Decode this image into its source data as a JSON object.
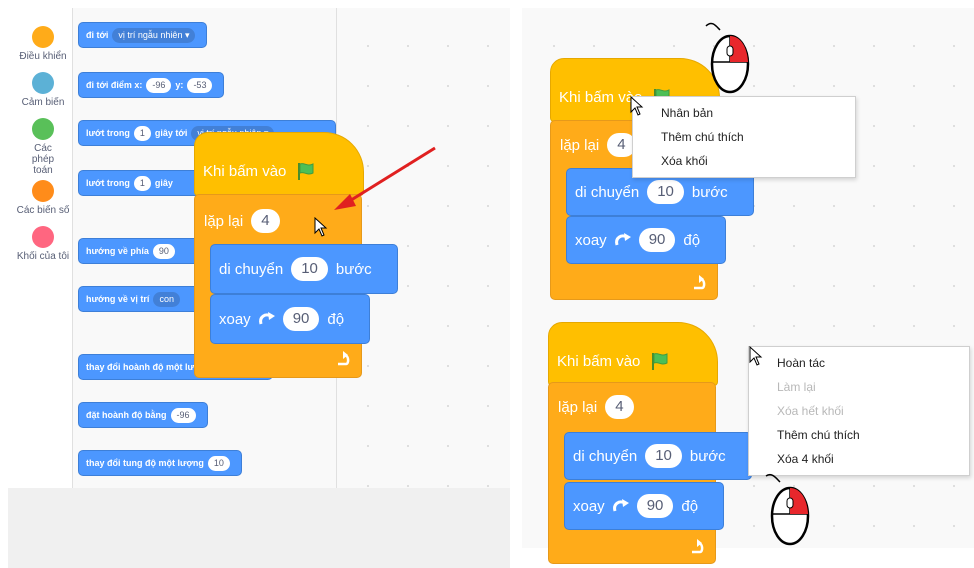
{
  "categories": [
    {
      "label": "Điều khiển",
      "color": "#ffab19"
    },
    {
      "label": "Cảm biến",
      "color": "#5cb1d6"
    },
    {
      "label": "Các phép toán",
      "color": "#59c059"
    },
    {
      "label": "Các biến số",
      "color": "#ff8c1a"
    },
    {
      "label": "Khối của tôi",
      "color": "#ff6680"
    }
  ],
  "palette": {
    "goto": {
      "label": "đi tới",
      "option": "vị trí ngẫu nhiên ▾"
    },
    "goto_xy": {
      "label": "đi tới điểm x:",
      "x": "-96",
      "ylabel": "y:",
      "y": "-53"
    },
    "glide1": {
      "label": "lướt trong",
      "secs": "1",
      "rest": "giây tới",
      "option": "vị trí ngẫu nhiên ▾"
    },
    "glide2": {
      "label": "lướt trong",
      "secs": "1",
      "rest": "giây"
    },
    "point_dir": {
      "label": "hướng về phía",
      "value": "90"
    },
    "point_towards": {
      "label": "hướng về vị trí",
      "option": "con"
    },
    "change_x": {
      "label": "thay đổi hoành độ một lượng"
    },
    "set_x": {
      "label": "đặt hoành độ bằng",
      "value": "-96"
    },
    "change_y": {
      "label": "thay đổi tung độ một lượng",
      "value": "10"
    }
  },
  "script": {
    "hat": "Khi bấm vào",
    "repeat_label": "lặp lại",
    "repeat_count": "4",
    "move_label": "di chuyển",
    "move_steps": "10",
    "move_unit": "bước",
    "turn_label": "xoay",
    "turn_deg": "90",
    "turn_unit": "độ"
  },
  "menu_block": [
    "Nhân bản",
    "Thêm chú thích",
    "Xóa khối"
  ],
  "menu_workspace": [
    {
      "label": "Hoàn tác",
      "enabled": true
    },
    {
      "label": "Làm lại",
      "enabled": false
    },
    {
      "label": "Xóa hết khối",
      "enabled": false
    },
    {
      "label": "Thêm chú thích",
      "enabled": true
    },
    {
      "label": "Xóa 4 khối",
      "enabled": true
    }
  ],
  "icons": [
    "green-flag-icon",
    "turn-right-icon",
    "loop-arrow-icon",
    "mouse-cursor-icon",
    "mouse-right-click-icon",
    "red-arrow-icon"
  ]
}
